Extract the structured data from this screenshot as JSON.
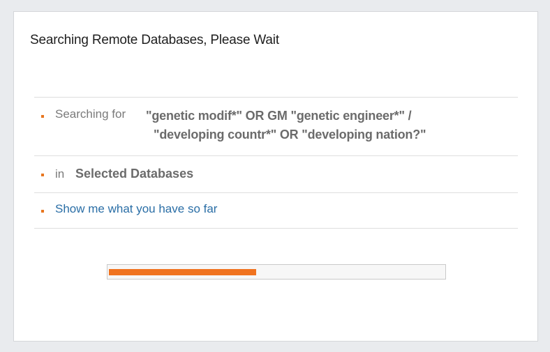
{
  "dialog": {
    "title": "Searching Remote Databases, Please Wait"
  },
  "search": {
    "prefix": "Searching for",
    "query_line1": "\"genetic modif*\" OR GM \"genetic engineer*\" /",
    "query_line2": "\"developing countr*\" OR \"developing nation?\""
  },
  "databases": {
    "prefix": "in",
    "name": "Selected Databases"
  },
  "actions": {
    "show_results_link": "Show me what you have so far"
  },
  "progress": {
    "fraction": 0.44
  },
  "colors": {
    "accent": "#f0731f",
    "link": "#2a6ea6"
  }
}
